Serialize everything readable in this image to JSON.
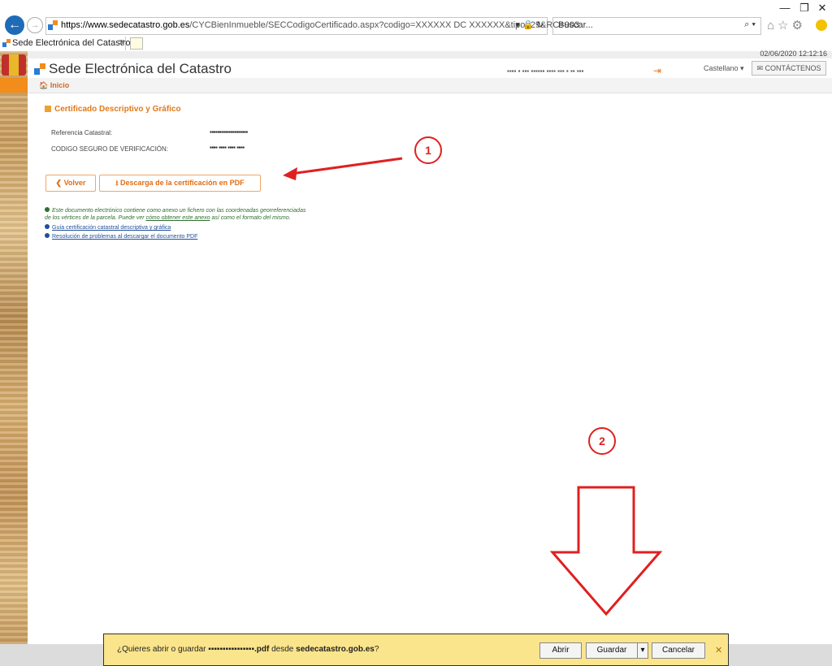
{
  "browser": {
    "window_controls": {
      "minimize": "—",
      "restore": "❐",
      "close": "✕"
    },
    "url_host": "https://www.sedecatastro.gob.es",
    "url_path": "/CYCBienInmueble/SECCodigoCertificado.aspx?codigo=XXXXXX DC XXXXXX&tipo=29&RC=903",
    "url_tail": "▾ 🔒 ↻",
    "search_placeholder": "Buscar...",
    "search_icon": "⌕ ▾",
    "toolbar_icons": "⌂☆⚙",
    "tab_title": "Sede Electrónica del Catastro",
    "tab_close": "✕"
  },
  "page": {
    "datetime": "02/06/2020 12:12:16",
    "site_title": "Sede Electrónica del Catastro",
    "user_masked": "▪▪▪▪ ▪ ▪▪▪ ▪▪▪▪▪▪ ▪▪▪▪ ▪▪▪ ▪ ▪▪ ▪▪▪ ",
    "logout_icon": "⇥",
    "language": "Castellano ▾",
    "contact": "✉ CONTÁCTENOS",
    "home": "🏠 Inicio",
    "section_title": "Certificado Descriptivo y Gráfico",
    "ref_label": "Referencia Catastral:",
    "ref_value": "▪▪▪▪▪▪▪▪▪▪▪▪▪▪▪▪▪▪▪▪",
    "csv_label": "CODIGO SEGURO DE VERIFICACIÓN:",
    "csv_value": "▪▪▪▪ ▪▪▪▪ ▪▪▪▪ ▪▪▪▪",
    "back_button": "❮ Volver",
    "pdf_button": "⭳ Descarga de la certificación en PDF",
    "info_line1": "Este documento electrónico contiene como anexo un fichero con las coordenadas georreferenciadas",
    "info_line2_pre": "de los vértices de la parcela. Puede ver ",
    "info_line2_link": "cómo obtener este anexo",
    "info_line2_post": " así como el formato del mismo.",
    "link1": "Guía certificación catastral descriptiva y gráfica",
    "link2": "Resolución de problemas al descargar el documento PDF"
  },
  "annotations": {
    "badge1": "1",
    "badge2": "2",
    "color": "#e02020"
  },
  "download_bar": {
    "prefix": "¿Quieres abrir o guardar ",
    "filename": "▪▪▪▪▪▪▪▪▪▪▪▪▪▪▪▪.pdf",
    "middle": " desde ",
    "host": "sedecatastro.gob.es",
    "suffix": "?",
    "open": "Abrir",
    "save": "Guardar",
    "save_menu": "▾",
    "cancel": "Cancelar",
    "close": "✕"
  }
}
